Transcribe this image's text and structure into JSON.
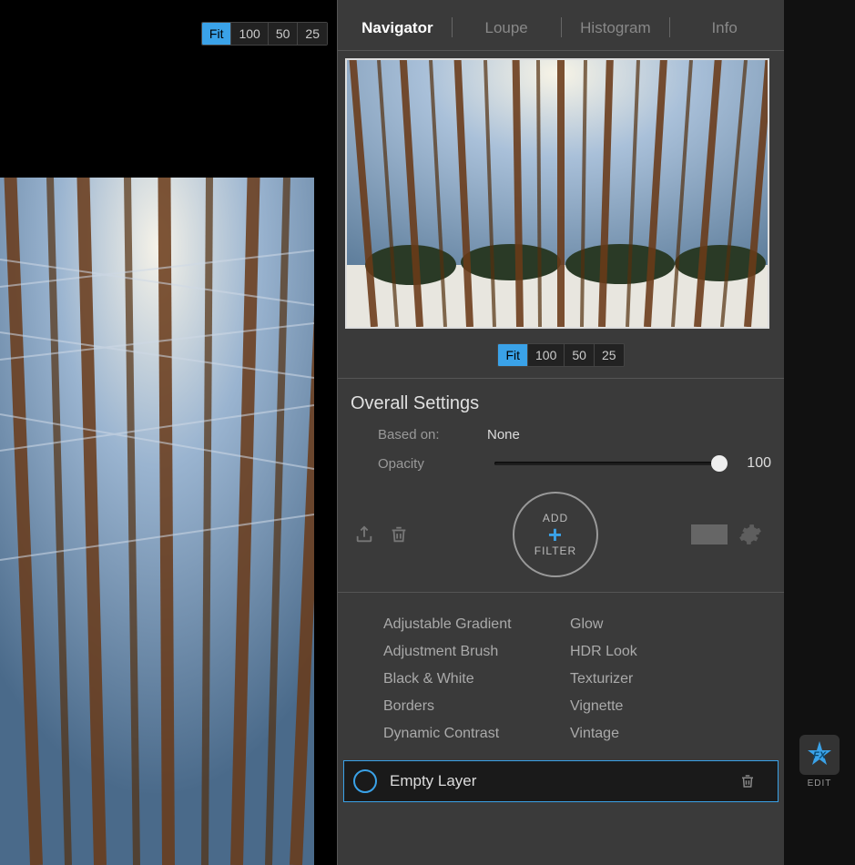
{
  "main_zoom": {
    "presets": [
      "Fit",
      "100",
      "50",
      "25"
    ],
    "active": "Fit"
  },
  "panel_tabs": [
    "Navigator",
    "Loupe",
    "Histogram",
    "Info"
  ],
  "panel_tab_active": "Navigator",
  "nav_zoom": {
    "presets": [
      "Fit",
      "100",
      "50",
      "25"
    ],
    "active": "Fit"
  },
  "settings": {
    "heading": "Overall Settings",
    "based_on_label": "Based on:",
    "based_on_value": "None",
    "opacity_label": "Opacity",
    "opacity_value": "100",
    "add_top": "ADD",
    "add_bottom": "FILTER"
  },
  "filters_col1": [
    "Adjustable Gradient",
    "Adjustment Brush",
    "Black & White",
    "Borders",
    "Dynamic Contrast"
  ],
  "filters_col2": [
    "Glow",
    "HDR Look",
    "Texturizer",
    "Vignette",
    "Vintage"
  ],
  "layer": {
    "name": "Empty Layer"
  },
  "tool": {
    "fx_label": "EDIT"
  }
}
